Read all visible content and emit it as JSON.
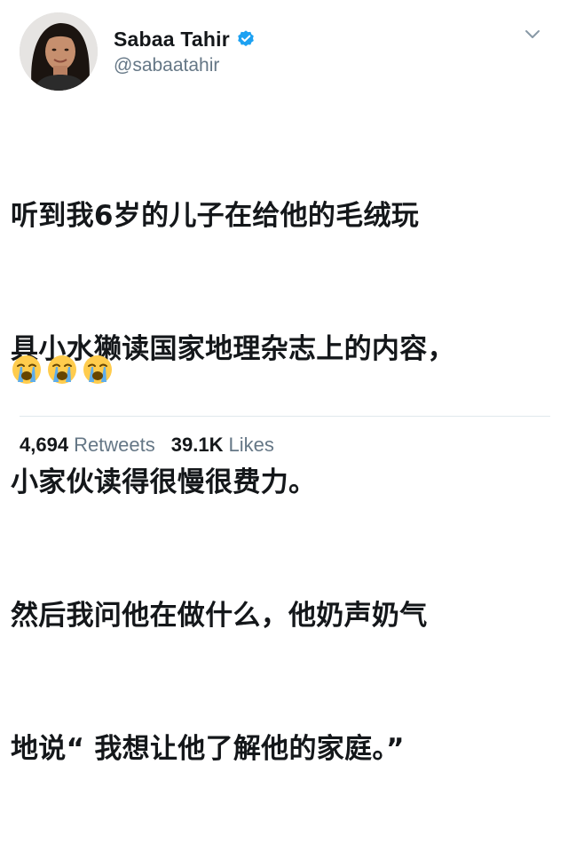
{
  "user": {
    "display_name": "Sabaa Tahir",
    "handle": "@sabaatahir",
    "verified": true
  },
  "tweet": {
    "lines": [
      "听到我6岁的儿子在给他的毛绒玩",
      "具小水獭读国家地理杂志上的内容，",
      "小家伙读得很慢很费力。",
      "然后我问他在做什么，他奶声奶气",
      "地说“ 我想让他了解他的家庭。”"
    ],
    "emojis": [
      "loudly-crying-face",
      "loudly-crying-face",
      "loudly-crying-face"
    ]
  },
  "stats": {
    "retweets_count": "4,694",
    "retweets_label": "Retweets",
    "likes_count": "39.1K",
    "likes_label": "Likes"
  },
  "colors": {
    "verified_blue": "#1da1f2",
    "secondary_text": "#657786",
    "primary_text": "#14171a",
    "divider": "#e1e8ed"
  }
}
